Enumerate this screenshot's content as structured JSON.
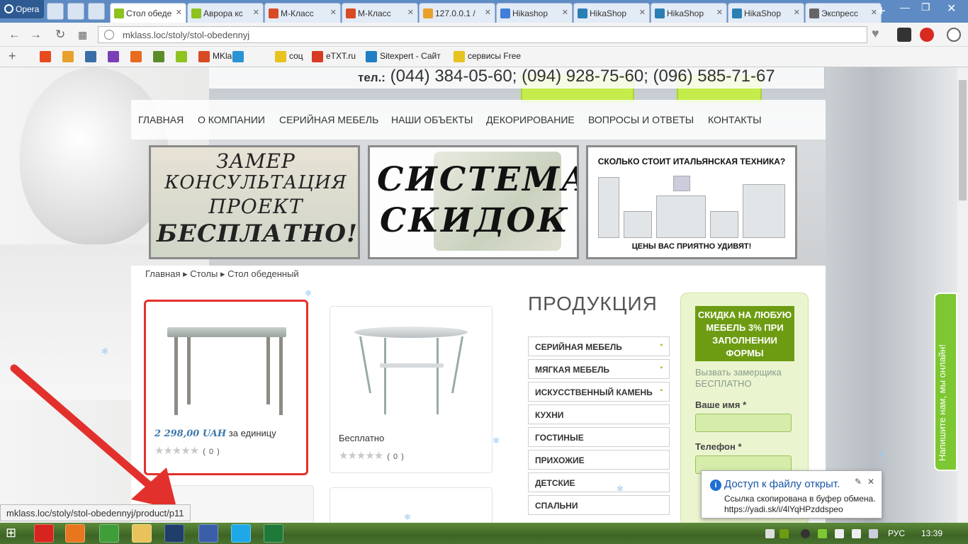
{
  "browser": {
    "opera_label": "Opera",
    "tabs": [
      {
        "label": "Стол обеде",
        "color": "#8ec21f",
        "active": true
      },
      {
        "label": "Аврора кс",
        "color": "#8ec21f"
      },
      {
        "label": "М-Класс",
        "color": "#d84a23"
      },
      {
        "label": "М-Класс",
        "color": "#d84a23"
      },
      {
        "label": "127.0.0.1 /",
        "color": "#e8a12a"
      },
      {
        "label": "Hikashop",
        "color": "#3f7fd9"
      },
      {
        "label": "HikaShop",
        "color": "#2a7fb5"
      },
      {
        "label": "HikaShop",
        "color": "#2a7fb5"
      },
      {
        "label": "HikaShop",
        "color": "#2a7fb5"
      },
      {
        "label": "Экспресс",
        "color": "#666666"
      }
    ],
    "new_tab": "+",
    "url": "mklass.loc/stoly/stol-obedennyj",
    "bookmarks": [
      {
        "label": "",
        "color": "#e84b1f"
      },
      {
        "label": "",
        "color": "#e8a12a"
      },
      {
        "label": "",
        "color": "#3a6ea8"
      },
      {
        "label": "",
        "color": "#7b3fb5"
      },
      {
        "label": "",
        "color": "#e86b1f"
      },
      {
        "label": "",
        "color": "#5b8c2a"
      },
      {
        "label": "",
        "color": "#8ec21f"
      },
      {
        "label": "MKlass",
        "color": "#d84a23"
      },
      {
        "label": "",
        "color": "#2a93d5"
      },
      {
        "label": "соц",
        "color": "#e8c21f"
      },
      {
        "label": "eTXT.ru",
        "color": "#d83a23"
      },
      {
        "label": "Sitexpert - Сайт",
        "color": "#1f7fc2"
      },
      {
        "label": "сервисы Free",
        "color": "#e8c21f"
      }
    ],
    "status_url": "mklass.loc/stoly/stol-obedennyj/product/p11"
  },
  "page": {
    "phone_label": "тел.:",
    "phone_numbers": "(044) 384-05-60; (094) 928-75-60; (096) 585-71-67",
    "menu": [
      "ГЛАВНАЯ",
      "О КОМПАНИИ",
      "СЕРИЙНАЯ МЕБЕЛЬ",
      "НАШИ ОБЪЕКТЫ",
      "ДЕКОРИРОВАНИЕ",
      "ВОПРОСЫ И ОТВЕТЫ",
      "КОНТАКТЫ"
    ],
    "banner1": [
      "ЗАМЕР",
      "КОНСУЛЬТАЦИЯ",
      "ПРОЕКТ",
      "БЕСПЛАТНО!!!"
    ],
    "banner2": [
      "СИСТЕМА",
      "СКИДОК"
    ],
    "banner3_top": "СКОЛЬКО СТОИТ ИТАЛЬЯНСКАЯ ТЕХНИКА?",
    "banner3_bottom": "ЦЕНЫ ВАС ПРИЯТНО УДИВЯТ!",
    "breadcrumbs": [
      "Главная",
      "Столы",
      "Стол обеденный"
    ],
    "products": [
      {
        "price": "2 298,00 UAH",
        "unit": " за единицу",
        "votes": "( 0 )"
      },
      {
        "price": "Бесплатно",
        "votes": "( 0 )"
      }
    ],
    "production_title": "ПРОДУКЦИЯ",
    "categories": [
      {
        "label": "СЕРИЙНАЯ МЕБЕЛЬ",
        "has_sub": true
      },
      {
        "label": "МЯГКАЯ МЕБЕЛЬ",
        "has_sub": true
      },
      {
        "label": "ИСКУССТВЕННЫЙ КАМЕНЬ",
        "has_sub": true
      },
      {
        "label": "КУХНИ"
      },
      {
        "label": "ГОСТИНЫЕ"
      },
      {
        "label": "ПРИХОЖИЕ"
      },
      {
        "label": "ДЕТСКИЕ"
      },
      {
        "label": "СПАЛЬНИ"
      }
    ],
    "form": {
      "head": "СКИДКА НА ЛЮБУЮ МЕБЕЛЬ 3% ПРИ ЗАПОЛНЕНИИ ФОРМЫ",
      "subtitle1": "Вызвать замерщика",
      "subtitle2": "БЕСПЛАТНО",
      "name_label": "Ваше имя *",
      "phone_label": "Телефон *"
    },
    "chat": "Напишите нам, мы онлайн!"
  },
  "notification": {
    "title": "Доступ к файлу открыт.",
    "line1": "Ссылка скопирована в буфер обмена.",
    "line2": "https://yadi.sk/i/4lYqHPzddspeo"
  },
  "taskbar": {
    "lang": "РУС",
    "time": "13:39",
    "apps": [
      {
        "name": "opera",
        "color": "#d8241f"
      },
      {
        "name": "firefox",
        "color": "#e8761f"
      },
      {
        "name": "chrome",
        "color": "#3f9d3a"
      },
      {
        "name": "explorer",
        "color": "#e8c25a"
      },
      {
        "name": "photoshop",
        "color": "#1f3f6a"
      },
      {
        "name": "save",
        "color": "#3a5fa8"
      },
      {
        "name": "skype",
        "color": "#1fa8e8"
      },
      {
        "name": "excel",
        "color": "#1f7a3a"
      }
    ]
  }
}
